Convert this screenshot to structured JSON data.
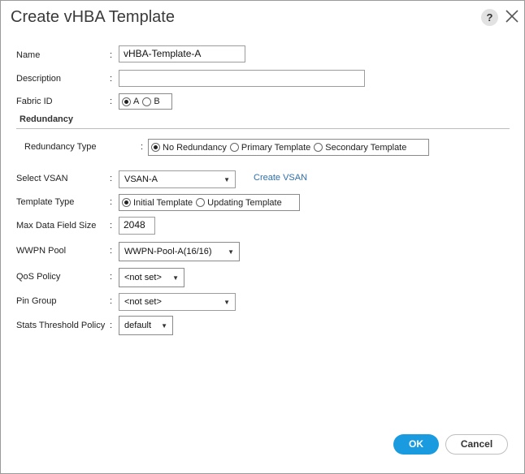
{
  "dialog": {
    "title": "Create vHBA Template",
    "help_label": "?"
  },
  "fields": {
    "name": {
      "label": "Name",
      "value": "vHBA-Template-A"
    },
    "description": {
      "label": "Description",
      "value": ""
    },
    "fabric_id": {
      "label": "Fabric ID",
      "options": [
        "A",
        "B"
      ],
      "selected": "A"
    },
    "redundancy_section": "Redundancy",
    "redundancy_type": {
      "label": "Redundancy Type",
      "options": [
        "No Redundancy",
        "Primary Template",
        "Secondary Template"
      ],
      "selected": "No Redundancy"
    },
    "select_vsan": {
      "label": "Select VSAN",
      "value": "VSAN-A",
      "create_link": "Create VSAN"
    },
    "template_type": {
      "label": "Template Type",
      "options": [
        "Initial Template",
        "Updating Template"
      ],
      "selected": "Initial Template"
    },
    "max_data_field_size": {
      "label": "Max Data Field Size",
      "value": "2048"
    },
    "wwpn_pool": {
      "label": "WWPN Pool",
      "value": "WWPN-Pool-A(16/16)"
    },
    "qos_policy": {
      "label": "QoS Policy",
      "value": "<not set>"
    },
    "pin_group": {
      "label": "Pin Group",
      "value": "<not set>"
    },
    "stats_threshold_policy": {
      "label": "Stats Threshold Policy",
      "value": "default"
    }
  },
  "colon": ":",
  "buttons": {
    "ok": "OK",
    "cancel": "Cancel"
  },
  "colors": {
    "accent": "#1a9be0",
    "link": "#2f6fa8"
  }
}
